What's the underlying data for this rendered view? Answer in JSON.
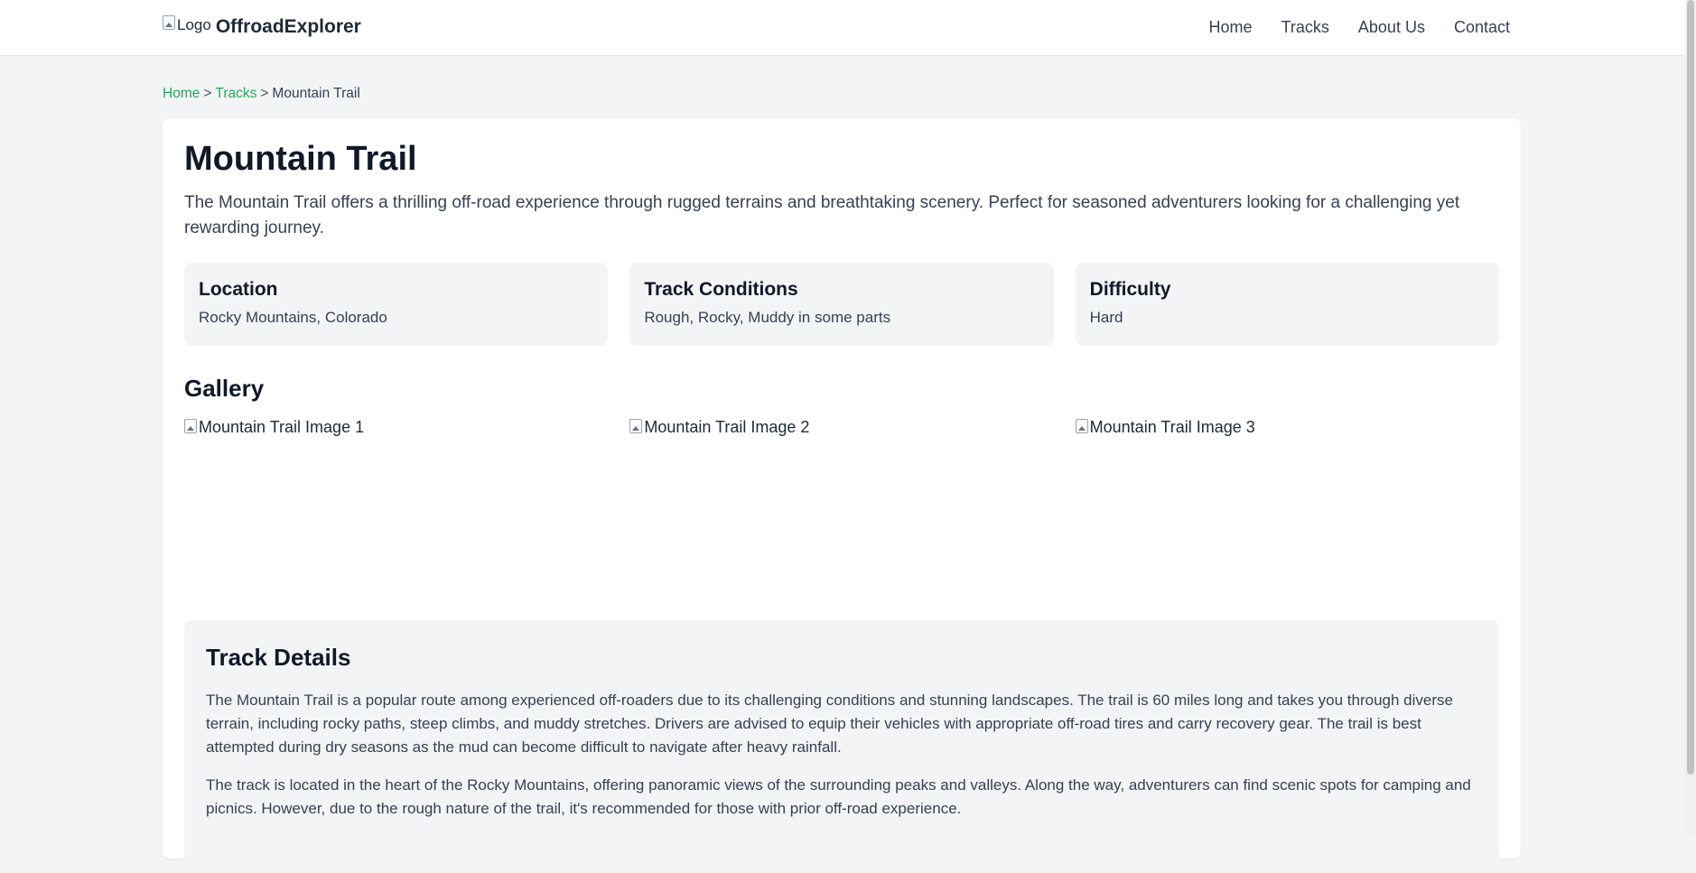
{
  "header": {
    "logo_alt": "Logo",
    "brand": "OffroadExplorer",
    "nav": [
      "Home",
      "Tracks",
      "About Us",
      "Contact"
    ]
  },
  "breadcrumb": {
    "home": "Home",
    "tracks": "Tracks",
    "current": "Mountain Trail",
    "separator": ">"
  },
  "track": {
    "title": "Mountain Trail",
    "intro": "The Mountain Trail offers a thrilling off-road experience through rugged terrains and breathtaking scenery. Perfect for seasoned adventurers looking for a challenging yet rewarding journey.",
    "info": [
      {
        "title": "Location",
        "value": "Rocky Mountains, Colorado"
      },
      {
        "title": "Track Conditions",
        "value": "Rough, Rocky, Muddy in some parts"
      },
      {
        "title": "Difficulty",
        "value": "Hard"
      }
    ]
  },
  "gallery": {
    "title": "Gallery",
    "images": [
      "Mountain Trail Image 1",
      "Mountain Trail Image 2",
      "Mountain Trail Image 3"
    ]
  },
  "details": {
    "title": "Track Details",
    "paragraphs": [
      "The Mountain Trail is a popular route among experienced off-roaders due to its challenging conditions and stunning landscapes. The trail is 60 miles long and takes you through diverse terrain, including rocky paths, steep climbs, and muddy stretches. Drivers are advised to equip their vehicles with appropriate off-road tires and carry recovery gear. The trail is best attempted during dry seasons as the mud can become difficult to navigate after heavy rainfall.",
      "The track is located in the heart of the Rocky Mountains, offering panoramic views of the surrounding peaks and valleys. Along the way, adventurers can find scenic spots for camping and picnics. However, due to the rough nature of the trail, it's recommended for those with prior off-road experience."
    ]
  },
  "colors": {
    "accent": "#22a85a",
    "page_bg": "#f3f4f6",
    "card_bg": "#ffffff"
  }
}
